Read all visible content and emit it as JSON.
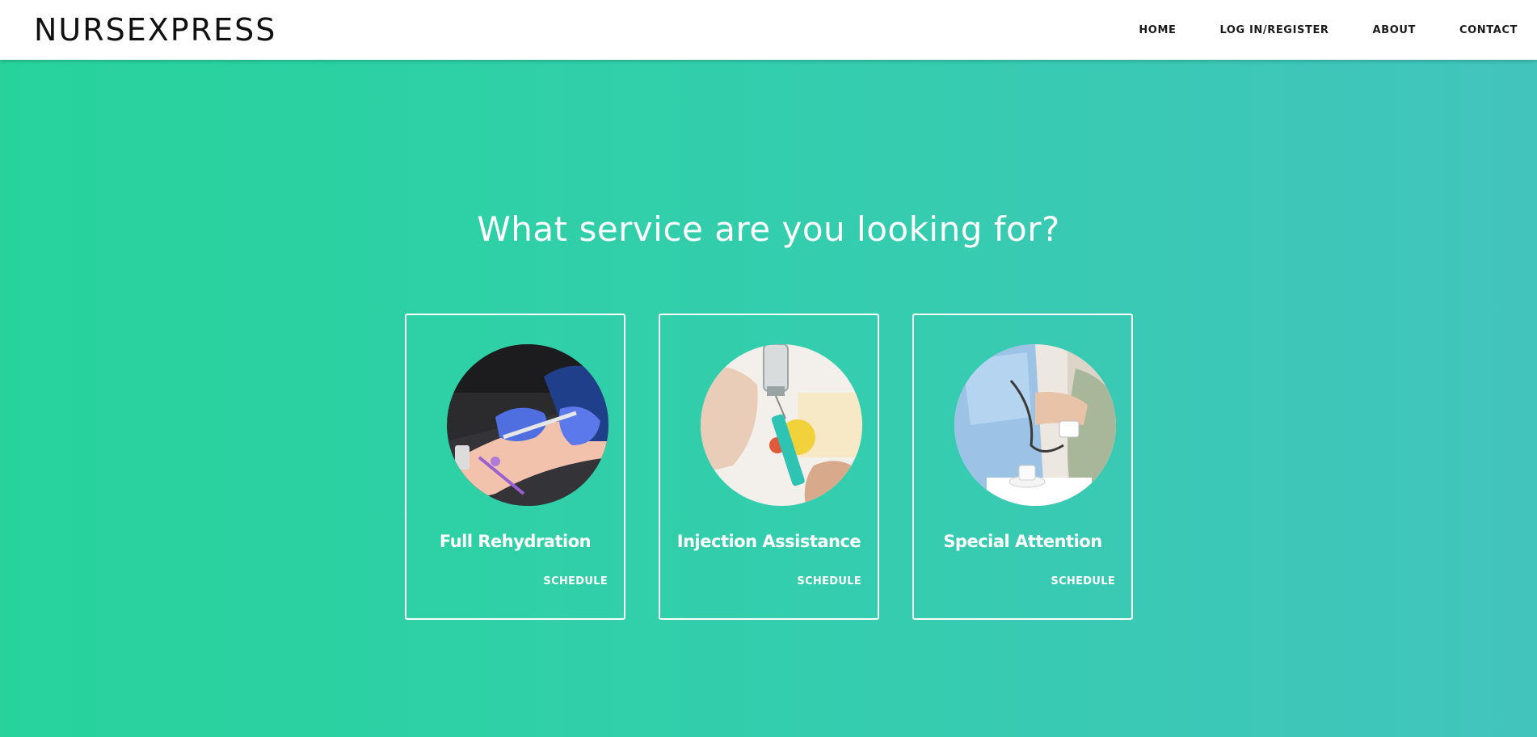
{
  "brand": {
    "name": "NURSEXPRESS"
  },
  "nav": {
    "home": "HOME",
    "login": "LOG IN/REGISTER",
    "about": "ABOUT",
    "contact": "CONTACT"
  },
  "main": {
    "heading": "What service are you looking for?",
    "services": [
      {
        "title": "Full Rehydration",
        "action": "SCHEDULE"
      },
      {
        "title": "Injection Assistance",
        "action": "SCHEDULE"
      },
      {
        "title": "Special Attention",
        "action": "SCHEDULE"
      }
    ]
  },
  "colors": {
    "gradient_start": "#27d39b",
    "gradient_end": "#42c4bd",
    "header_bg": "#ffffff",
    "text_on_accent": "#ffffff"
  }
}
